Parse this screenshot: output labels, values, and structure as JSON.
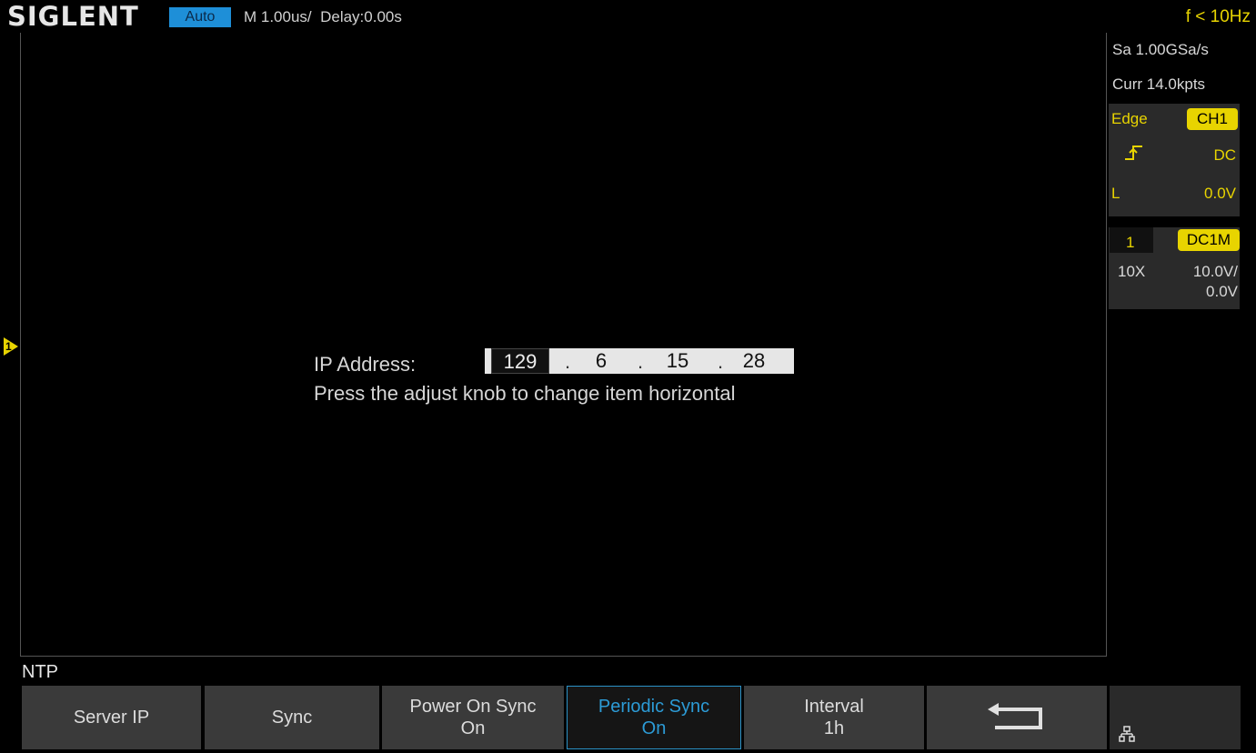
{
  "header": {
    "brand": "SIGLENT",
    "trigger_mode": "Auto",
    "timebase": "M 1.00us/  Delay:0.00s",
    "frequency": "f < 10Hz"
  },
  "channel_marker": "1",
  "dialog": {
    "ip_label": "IP Address:",
    "ip_octets": [
      "129",
      "6",
      "15",
      "28"
    ],
    "hint": "Press the adjust knob to change item horizontal"
  },
  "right_panel": {
    "sample_rate": "Sa 1.00GSa/s",
    "memory": "Curr 14.0kpts",
    "trigger": {
      "type": "Edge",
      "source": "CH1",
      "coupling": "DC",
      "level_label": "L",
      "level": "0.0V"
    },
    "channel": {
      "number": "1",
      "coupling": "DC1M",
      "probe": "10X",
      "scale": "10.0V/",
      "offset": "0.0V"
    }
  },
  "menu": {
    "title": "NTP",
    "softkeys": [
      {
        "label": "Server IP",
        "value": ""
      },
      {
        "label": "Sync",
        "value": ""
      },
      {
        "label": "Power On Sync",
        "value": "On"
      },
      {
        "label": "Periodic Sync",
        "value": "On"
      },
      {
        "label": "Interval",
        "value": "1h"
      }
    ]
  },
  "icons": {
    "back": "return-arrow-icon",
    "network": "network-icon"
  },
  "colors": {
    "trigger_accent": "#e8d400",
    "active_softkey": "#2c9bd6",
    "mode_badge": "#1e8fd8"
  }
}
